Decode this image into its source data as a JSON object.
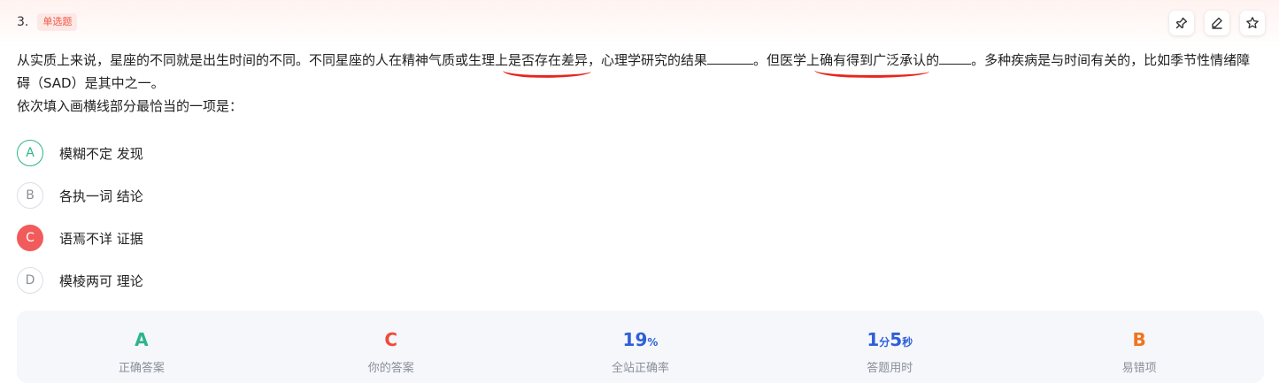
{
  "question": {
    "number": "3.",
    "type_badge": "单选题",
    "stem": {
      "p1_a": "从实质上来说，星座的不同就是出生时间的不同。不同星座的人在精神气质或生理上",
      "p1_u1": "是否存在差异",
      "p1_b": "，心理学研究的结果",
      "p1_c": "。但医学上",
      "p1_u2": "确有得到广泛承认",
      "p1_d": "的",
      "p1_e": "。多种疾病是与时间有关的，比如季节性情绪障碍（SAD）是其中之一。",
      "p2": "依次填入画横线部分最恰当的一项是："
    },
    "options": [
      {
        "letter": "A",
        "text": "模糊不定 发现",
        "state": "correct"
      },
      {
        "letter": "B",
        "text": "各执一词 结论",
        "state": "normal"
      },
      {
        "letter": "C",
        "text": "语焉不详 证据",
        "state": "selected-wrong"
      },
      {
        "letter": "D",
        "text": "模棱两可 理论",
        "state": "normal"
      }
    ]
  },
  "toolbar": {
    "icons": [
      "pin-icon",
      "edit-icon",
      "star-icon"
    ]
  },
  "stats": {
    "correct_answer": {
      "value": "A",
      "label": "正确答案",
      "color": "#2bb58a"
    },
    "your_answer": {
      "value": "C",
      "label": "你的答案",
      "color": "#f04b3c"
    },
    "accuracy": {
      "value": "19",
      "unit": "%",
      "label": "全站正确率",
      "color": "#2f5fd8"
    },
    "time": {
      "min": "1",
      "min_unit": "分",
      "sec": "5",
      "sec_unit": "秒",
      "label": "答题用时",
      "color": "#2f5fd8"
    },
    "common_wrong": {
      "value": "B",
      "label": "易错项",
      "color": "#f0731e"
    }
  },
  "colors": {
    "underline": "#e8241c",
    "badge_text": "#f05a4a",
    "badge_bg": "#fde8e5"
  }
}
